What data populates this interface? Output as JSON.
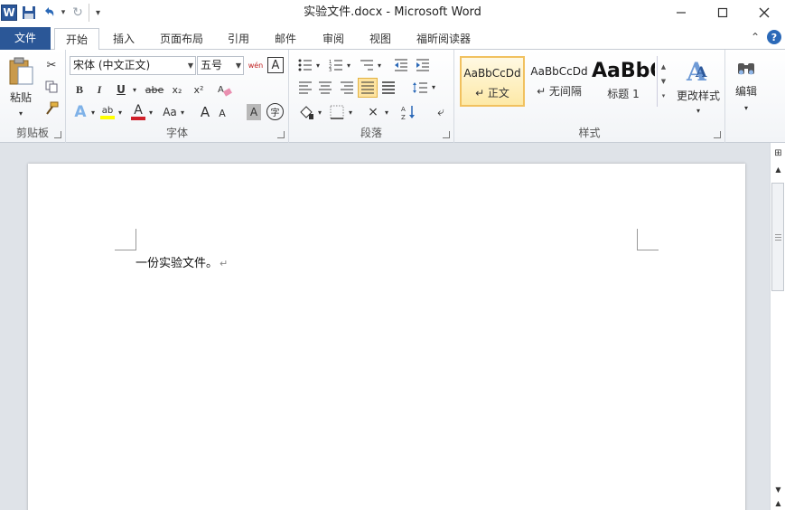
{
  "titlebar": {
    "title": "实验文件.docx - Microsoft Word",
    "logo_letter": "W"
  },
  "qat": {
    "items": [
      {
        "name": "save-icon",
        "glyph": "💾"
      },
      {
        "name": "undo-icon",
        "glyph": "↶"
      },
      {
        "name": "undo-dropdown-icon",
        "glyph": "▾"
      },
      {
        "name": "redo-icon",
        "glyph": "↻"
      },
      {
        "name": "customize-qat-icon",
        "glyph": "▾"
      }
    ]
  },
  "window_controls": {
    "minimize": "—",
    "maximize": "☐",
    "close": "✕"
  },
  "tabs": [
    {
      "label": "文件",
      "key": "file"
    },
    {
      "label": "开始",
      "key": "home"
    },
    {
      "label": "插入",
      "key": "insert"
    },
    {
      "label": "页面布局",
      "key": "layout"
    },
    {
      "label": "引用",
      "key": "references"
    },
    {
      "label": "邮件",
      "key": "mailings"
    },
    {
      "label": "审阅",
      "key": "review"
    },
    {
      "label": "视图",
      "key": "view"
    },
    {
      "label": "福昕阅读器",
      "key": "foxit"
    }
  ],
  "tabs_right": {
    "collapse": "⌃",
    "help": "?"
  },
  "clipboard": {
    "label": "剪贴板",
    "paste_label": "粘贴"
  },
  "font": {
    "label": "字体",
    "font_name": "宋体 (中文正文)",
    "font_size": "五号",
    "bold": "B",
    "italic": "I",
    "underline": "U",
    "strike": "abe",
    "subscript": "x₂",
    "superscript": "x²",
    "grow": "A",
    "shrink": "A",
    "change_case": "Aa",
    "char_shading": "A",
    "enclose": "字",
    "phonetic": "wén",
    "char_border": "A"
  },
  "paragraph": {
    "label": "段落"
  },
  "styles": {
    "label": "样式",
    "items": [
      {
        "sample": "AaBbCcDd",
        "name": "↵ 正文"
      },
      {
        "sample": "AaBbCcDd",
        "name": "↵ 无间隔"
      },
      {
        "sample": "AaBbC",
        "name": "标题 1"
      }
    ],
    "change_styles_label": "更改样式"
  },
  "editing": {
    "label": "编辑"
  },
  "document": {
    "text": "一份实验文件。",
    "paragraph_mark": "↵"
  },
  "colors": {
    "file_tab": "#2b5797",
    "selected_style_border": "#f1c15f",
    "font_color_bar": "#d0202a",
    "highlight_bar": "#ffff00"
  }
}
